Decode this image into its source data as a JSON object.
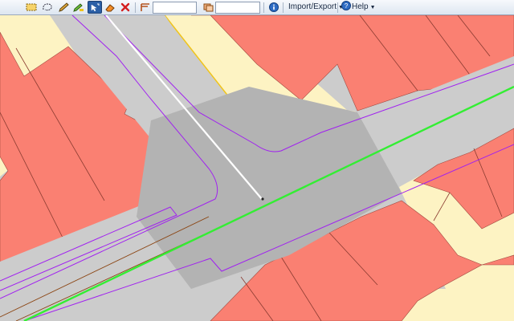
{
  "toolbar": {
    "tools": [
      {
        "name": "select-area-tool",
        "icon": "select-rectangle-icon",
        "active": false
      },
      {
        "name": "select-polygon-tool",
        "icon": "lasso-icon",
        "active": false
      },
      {
        "name": "draw-tool",
        "icon": "pencil-icon",
        "active": false
      },
      {
        "name": "edit-tool",
        "icon": "edit-pencil-icon",
        "active": false
      },
      {
        "name": "pointer-tool",
        "icon": "arrow-cursor-icon",
        "active": true
      },
      {
        "name": "erase-tool",
        "icon": "eraser-icon",
        "active": false
      },
      {
        "name": "delete-tool",
        "icon": "red-x-icon",
        "active": false
      }
    ],
    "filter_input_1": {
      "value": "",
      "placeholder": ""
    },
    "filter_input_2": {
      "value": "",
      "placeholder": ""
    },
    "import_export_label": "Import/Export",
    "help_label": "Help"
  },
  "colors": {
    "building": "#fa8072",
    "landuse": "#fdf3c3",
    "road": "#cccccc",
    "junction": "#b3b3b3",
    "road_edge": "#a020f0",
    "selected_way": "#33ee33",
    "divider": "#ffffff",
    "boundary": "#f0c419",
    "tram_line": "#8b4513"
  }
}
